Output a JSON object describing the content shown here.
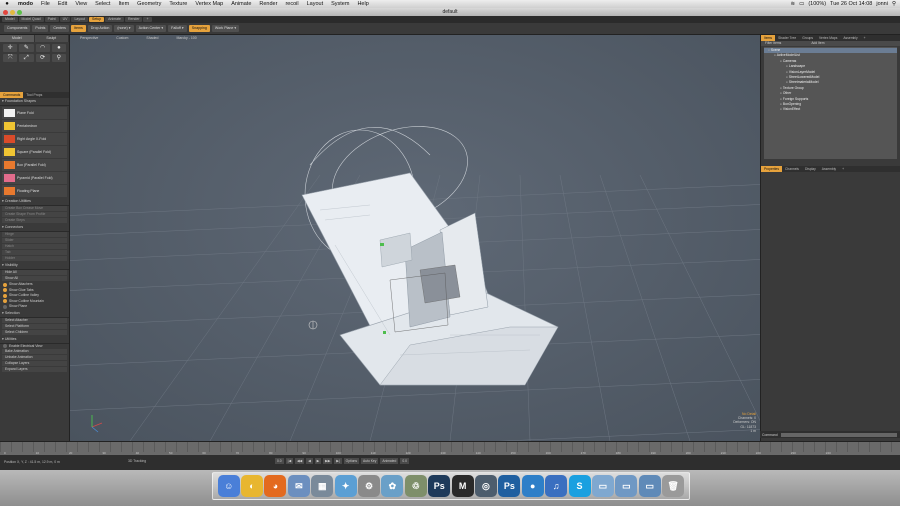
{
  "menubar": {
    "apple": "",
    "items": [
      "modo",
      "File",
      "Edit",
      "View",
      "Select",
      "Item",
      "Geometry",
      "Texture",
      "Vertex Map",
      "Animate",
      "Render",
      "recoil",
      "Layout",
      "System",
      "Help"
    ],
    "status": "(100%)",
    "date": "Tue 26 Oct  14:08",
    "user": "jonni"
  },
  "window": {
    "title": "default"
  },
  "layout_tabs": [
    "Model",
    "Model Quad",
    "Paint",
    "UV",
    "Layout",
    "Setup",
    "Animate",
    "Render",
    "+"
  ],
  "active_layout_tab": "Setup",
  "toolbar": {
    "items": [
      {
        "label": "Components",
        "kind": "btn"
      },
      {
        "label": "Points",
        "kind": "btn"
      },
      {
        "label": "Centers",
        "kind": "btn"
      },
      {
        "label": "Items",
        "kind": "orange"
      },
      {
        "label": "Drop Action",
        "kind": "btn"
      },
      {
        "label": "(none)",
        "kind": "dd"
      },
      {
        "label": "Action Center",
        "kind": "dd"
      },
      {
        "label": "Falloff",
        "kind": "dd"
      },
      {
        "label": "Snapping",
        "kind": "orange"
      },
      {
        "label": "Work Plane",
        "kind": "dd"
      }
    ]
  },
  "left": {
    "tabs": [
      "Model",
      "Sculpt"
    ],
    "subtabs": [
      "Commands",
      "Tool Props"
    ],
    "section_foundation": "Foundation Shapes",
    "shapes": [
      {
        "label": "Plane Fold",
        "color": "#f2f2f2"
      },
      {
        "label": "Pentahedron",
        "color": "#f0c533"
      },
      {
        "label": "Right Angle X-Fold",
        "color": "#d94b2a"
      },
      {
        "label": "Square (Parallel Fold)",
        "color": "#f0c533"
      },
      {
        "label": "Box (Parallel Fold)",
        "color": "#e8792e"
      },
      {
        "label": "Pyramid (Parallel Fold)",
        "color": "#e26c8c"
      },
      {
        "label": "Floating Plane",
        "color": "#e8792e"
      }
    ],
    "section_creation": "Creation Utilities",
    "creation_items": [
      "Create Box Crease Move",
      "Create Shape From Profile",
      "Create Steps"
    ],
    "section_connectors": "Connectors",
    "connector_items": [
      "Hinge",
      "Slider",
      "Hatch",
      "Tab",
      "Holder"
    ],
    "section_visibility": "Visibility",
    "visibility_items": [
      "Hide All",
      "Show All"
    ],
    "toggles": [
      {
        "label": "Show Attachers",
        "on": true
      },
      {
        "label": "Show Glue Tabs",
        "on": true
      },
      {
        "label": "Show Cutline Valley",
        "on": true
      },
      {
        "label": "Show Cutline Mountain",
        "on": true
      },
      {
        "label": "Show Plane",
        "on": false
      }
    ],
    "section_selection": "Selection",
    "selection_items": [
      "Select Attacher",
      "Select Plattform",
      "Select Children"
    ],
    "section_utilities": "Utilities",
    "utility_toggle": "Enable Electrical View",
    "utility_items": [
      "Bake Animation",
      "Unbake Animation",
      "Collapse Layers",
      "Expand Layers"
    ]
  },
  "viewport": {
    "header": [
      "Perspective",
      "Custom",
      "Shaded",
      "Marcky - 100"
    ],
    "info_title": "No Detail",
    "info_lines": [
      "Channels: 0",
      "Deformers: ON",
      "GL: 11873",
      "1 m"
    ]
  },
  "right": {
    "tabs": [
      "Items",
      "Shader Tree",
      "Groups",
      "Vertex Maps",
      "Assembly",
      "+"
    ],
    "active_tab": "Items",
    "columns": [
      "Filter Items",
      "Add Item"
    ],
    "tree": [
      {
        "label": "Scene",
        "depth": 0,
        "selected": true
      },
      {
        "label": "ActiveModelList",
        "depth": 1,
        "selected": false
      },
      {
        "label": "Cameras",
        "depth": 2,
        "selected": false
      },
      {
        "label": "Landscape",
        "depth": 3,
        "selected": false
      },
      {
        "label": "VisionLayerModel",
        "depth": 3,
        "selected": false
      },
      {
        "label": "StreetLoweredModel",
        "depth": 3,
        "selected": false
      },
      {
        "label": "StreetmaterialModel",
        "depth": 3,
        "selected": false
      },
      {
        "label": "Texture Group",
        "depth": 2,
        "selected": false
      },
      {
        "label": "Other",
        "depth": 2,
        "selected": false
      },
      {
        "label": "Foreign Supports",
        "depth": 2,
        "selected": false
      },
      {
        "label": "BoxOpening",
        "depth": 2,
        "selected": false
      },
      {
        "label": "VisionEffect",
        "depth": 2,
        "selected": false
      }
    ],
    "props_tabs": [
      "Properties",
      "Channels",
      "Display",
      "Assembly",
      "+"
    ],
    "active_props_tab": "Properties"
  },
  "command": {
    "label": "Command"
  },
  "timeline": {
    "ticks": [
      "0",
      "10",
      "20",
      "30",
      "40",
      "50",
      "60",
      "70",
      "80",
      "90",
      "100",
      "110",
      "120",
      "130",
      "140",
      "150",
      "160",
      "170",
      "180",
      "190",
      "200",
      "210",
      "220",
      "230",
      "240"
    ]
  },
  "status": {
    "position": "Position X, Y, Z : 41.5 m, 12.9 m, 0 m",
    "mode": "3D Tracking",
    "controls": [
      "0.0",
      "Options",
      "Auto Key",
      "Animated",
      "0.0"
    ]
  },
  "dock": {
    "icons": [
      {
        "name": "finder-icon",
        "glyph": "☺",
        "color": "#4a7fd8"
      },
      {
        "name": "chrome-icon",
        "glyph": "◐",
        "color": "#e8b630"
      },
      {
        "name": "firefox-icon",
        "glyph": "◕",
        "color": "#e36a1f"
      },
      {
        "name": "mail-icon",
        "glyph": "✉",
        "color": "#6c8fbf"
      },
      {
        "name": "preview-icon",
        "glyph": "▦",
        "color": "#7a8a9a"
      },
      {
        "name": "safari-icon",
        "glyph": "✦",
        "color": "#5b9fd4"
      },
      {
        "name": "system-preferences-icon",
        "glyph": "⚙",
        "color": "#8a8a8a"
      },
      {
        "name": "photos-icon",
        "glyph": "✿",
        "color": "#6aa0c8"
      },
      {
        "name": "trash-can-icon",
        "glyph": "♲",
        "color": "#7e8f6a"
      },
      {
        "name": "photoshop-icon",
        "glyph": "Ps",
        "color": "#1e3a5a"
      },
      {
        "name": "modo-icon",
        "glyph": "M",
        "color": "#2a2a2a"
      },
      {
        "name": "aperture-icon",
        "glyph": "◎",
        "color": "#4d5d6d"
      },
      {
        "name": "photoshop-cs-icon",
        "glyph": "Ps",
        "color": "#1f5fa0"
      },
      {
        "name": "globe-icon",
        "glyph": "●",
        "color": "#2e7fc8"
      },
      {
        "name": "itunes-icon",
        "glyph": "♫",
        "color": "#3a6fc0"
      },
      {
        "name": "skype-icon",
        "glyph": "S",
        "color": "#1aa0e0"
      },
      {
        "name": "folder-icon",
        "glyph": "▭",
        "color": "#7fa8d0"
      },
      {
        "name": "applications-folder-icon",
        "glyph": "▭",
        "color": "#6f98c4"
      },
      {
        "name": "downloads-folder-icon",
        "glyph": "▭",
        "color": "#5f8ab8"
      },
      {
        "name": "trash-icon",
        "glyph": "🗑",
        "color": "#9a9a9a"
      }
    ]
  }
}
